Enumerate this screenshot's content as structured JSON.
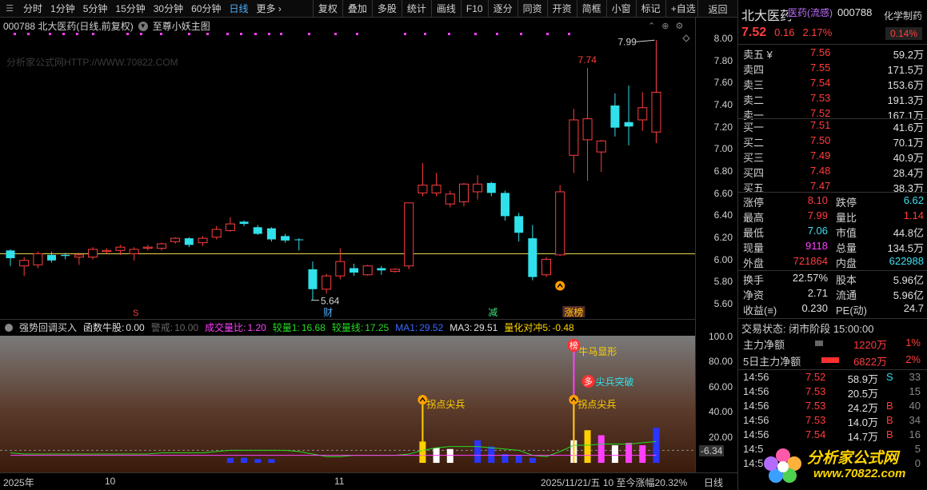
{
  "toolbar": {
    "periods": [
      "分时",
      "1分钟",
      "5分钟",
      "15分钟",
      "30分钟",
      "60分钟",
      "日线",
      "更多 ›"
    ],
    "active_period": "日线",
    "buttons": [
      "复权",
      "叠加",
      "多股",
      "统计",
      "画线",
      "F10",
      "逐分",
      "同资",
      "开资",
      "简框",
      "小窗",
      "标记",
      "+自选"
    ],
    "return_label": "返回"
  },
  "chart_header": {
    "code_text": "000788 北大医药(日线,前复权)",
    "formula_name": "至尊小妖主图",
    "watermark": "分析家公式网HTTP://WWW.70822.COM"
  },
  "main_chart": {
    "price_ticks": [
      "8.00",
      "7.80",
      "7.60",
      "7.40",
      "7.20",
      "7.00",
      "6.80",
      "6.60",
      "6.40",
      "6.20",
      "6.00",
      "5.80",
      "5.60"
    ],
    "annotations": {
      "high_label": "7.99",
      "high_mid_label": "7.74",
      "low_label": "5.64",
      "tag_cai": "财",
      "tag_jian": "减",
      "tag_zhangting": "涨榜",
      "tag_s": "S"
    }
  },
  "indicator": {
    "name": "强势回调买入",
    "items": [
      {
        "label": "函数牛股:",
        "value": "0.00",
        "color": "#e0e0e0"
      },
      {
        "label": "警戒:",
        "value": "10.00",
        "color": "#666666"
      },
      {
        "label": "成交量比:",
        "value": "1.20",
        "color": "#ff40ff"
      },
      {
        "label": "较量1:",
        "value": "16.68",
        "color": "#22dd22"
      },
      {
        "label": "较量线:",
        "value": "17.25",
        "color": "#22dd22"
      },
      {
        "label": "MA1:",
        "value": "29.52",
        "color": "#3a6cff"
      },
      {
        "label": "MA3:",
        "value": "29.51",
        "color": "#e0e0e0"
      },
      {
        "label": "量化对冲5:",
        "value": "-0.48",
        "color": "#ffd500"
      }
    ],
    "axis_ticks": [
      "100.0",
      "80.00",
      "60.00",
      "40.00",
      "20.00"
    ],
    "bottom_value": "-6.34",
    "signals": {
      "bang": "榜",
      "niuma": "牛马显形",
      "duo": "多",
      "jianbing": "尖兵突破",
      "guaidian1": "拐点尖兵",
      "guaidian2": "拐点尖兵"
    }
  },
  "date_bar": {
    "year": "2025年",
    "m10": "10",
    "m11": "11",
    "cursor": "2025/11/21/五 10 至今涨幅20.32%",
    "period": "日线"
  },
  "quote": {
    "name": "北大医药",
    "sector": "医药(流感)",
    "code": "000788",
    "industry": "化学制药",
    "price": "7.52",
    "change": "0.16",
    "change_pct": "2.17%",
    "industry_pct": "0.14%",
    "asks": [
      {
        "label": "卖五 ¥",
        "price": "7.56",
        "vol": "59.2万"
      },
      {
        "label": "卖四",
        "price": "7.55",
        "vol": "171.5万"
      },
      {
        "label": "卖三",
        "price": "7.54",
        "vol": "153.6万"
      },
      {
        "label": "卖二",
        "price": "7.53",
        "vol": "191.3万"
      },
      {
        "label": "卖一",
        "price": "7.52",
        "vol": "167.1万"
      }
    ],
    "bids": [
      {
        "label": "买一",
        "price": "7.51",
        "vol": "41.6万"
      },
      {
        "label": "买二",
        "price": "7.50",
        "vol": "70.1万"
      },
      {
        "label": "买三",
        "price": "7.49",
        "vol": "40.9万"
      },
      {
        "label": "买四",
        "price": "7.48",
        "vol": "28.4万"
      },
      {
        "label": "买五",
        "price": "7.47",
        "vol": "38.3万"
      }
    ],
    "stats1": [
      {
        "l1": "涨停",
        "v1": "8.10",
        "c1": "c-red",
        "l2": "跌停",
        "v2": "6.62",
        "c2": "c-cyan"
      },
      {
        "l1": "最高",
        "v1": "7.99",
        "c1": "c-red",
        "l2": "量比",
        "v2": "1.14",
        "c2": "c-red"
      },
      {
        "l1": "最低",
        "v1": "7.06",
        "c1": "c-cyan",
        "l2": "市值",
        "v2": "44.8亿",
        "c2": "c-white"
      },
      {
        "l1": "现量",
        "v1": "9118",
        "c1": "c-mag",
        "l2": "总量",
        "v2": "134.5万",
        "c2": "c-white"
      },
      {
        "l1": "外盘",
        "v1": "721864",
        "c1": "c-red",
        "l2": "内盘",
        "v2": "622988",
        "c2": "c-cyan"
      }
    ],
    "stats2": [
      {
        "l1": "换手",
        "v1": "22.57%",
        "c1": "c-white",
        "l2": "股本",
        "v2": "5.96亿",
        "c2": "c-white"
      },
      {
        "l1": "净资",
        "v1": "2.71",
        "c1": "c-white",
        "l2": "流通",
        "v2": "5.96亿",
        "c2": "c-white"
      },
      {
        "l1": "收益(≡)",
        "v1": "0.230",
        "c1": "c-white",
        "l2": "PE(动)",
        "v2": "24.7",
        "c2": "c-white"
      }
    ],
    "trade_status": "交易状态: 闭市阶段 15:00:00",
    "main_flow_label": "主力净额",
    "main_flow_value": "1220万",
    "main_flow_pct": "1%",
    "flow5_label": "5日主力净额",
    "flow5_value": "6822万",
    "flow5_pct": "2%",
    "ticks": [
      {
        "time": "14:56",
        "price": "7.52",
        "vol": "58.9万",
        "side": "S",
        "n": "33"
      },
      {
        "time": "14:56",
        "price": "7.53",
        "vol": "20.5万",
        "side": "",
        "n": "15"
      },
      {
        "time": "14:56",
        "price": "7.53",
        "vol": "24.2万",
        "side": "B",
        "n": "40"
      },
      {
        "time": "14:56",
        "price": "7.53",
        "vol": "14.0万",
        "side": "B",
        "n": "34"
      },
      {
        "time": "14:56",
        "price": "7.54",
        "vol": "14.7万",
        "side": "B",
        "n": "16"
      },
      {
        "time": "14:5",
        "price": "",
        "vol": "",
        "side": "",
        "n": "5"
      },
      {
        "time": "14:5",
        "price": "",
        "vol": "",
        "side": "",
        "n": "0"
      }
    ],
    "logo_main": "分析家公式网",
    "logo_url": "www.70822.com"
  },
  "chart_data": [
    {
      "type": "candlestick",
      "title": "000788 北大医药(日线,前复权)",
      "ylim": [
        5.5,
        8.05
      ],
      "reference_line": 6.06,
      "candles": [
        {
          "o": 6.02,
          "h": 6.1,
          "l": 5.95,
          "c": 6.09,
          "up": false
        },
        {
          "o": 6.0,
          "h": 6.03,
          "l": 5.86,
          "c": 5.95,
          "up": true
        },
        {
          "o": 5.96,
          "h": 6.08,
          "l": 5.93,
          "c": 6.06,
          "up": true
        },
        {
          "o": 6.05,
          "h": 6.08,
          "l": 5.98,
          "c": 6.0,
          "up": false
        },
        {
          "o": 6.05,
          "h": 6.07,
          "l": 6.01,
          "c": 6.04,
          "up": false
        },
        {
          "o": 6.03,
          "h": 6.07,
          "l": 5.96,
          "c": 6.05,
          "up": true
        },
        {
          "o": 6.03,
          "h": 6.12,
          "l": 6.01,
          "c": 6.1,
          "up": true
        },
        {
          "o": 6.08,
          "h": 6.11,
          "l": 6.06,
          "c": 6.09,
          "up": true
        },
        {
          "o": 6.09,
          "h": 6.14,
          "l": 6.05,
          "c": 6.12,
          "up": true
        },
        {
          "o": 6.1,
          "h": 6.12,
          "l": 6.0,
          "c": 6.06,
          "up": true
        },
        {
          "o": 6.11,
          "h": 6.14,
          "l": 6.09,
          "c": 6.12,
          "up": true
        },
        {
          "o": 6.11,
          "h": 6.16,
          "l": 6.09,
          "c": 6.15,
          "up": true
        },
        {
          "o": 6.17,
          "h": 6.21,
          "l": 6.15,
          "c": 6.2,
          "up": true
        },
        {
          "o": 6.2,
          "h": 6.21,
          "l": 6.12,
          "c": 6.14,
          "up": false
        },
        {
          "o": 6.16,
          "h": 6.22,
          "l": 6.13,
          "c": 6.2,
          "up": true
        },
        {
          "o": 6.21,
          "h": 6.31,
          "l": 6.19,
          "c": 6.28,
          "up": true
        },
        {
          "o": 6.27,
          "h": 6.39,
          "l": 6.26,
          "c": 6.33,
          "up": true
        },
        {
          "o": 6.35,
          "h": 6.36,
          "l": 6.31,
          "c": 6.33,
          "up": false
        },
        {
          "o": 6.3,
          "h": 6.32,
          "l": 6.23,
          "c": 6.24,
          "up": false
        },
        {
          "o": 6.29,
          "h": 6.3,
          "l": 6.17,
          "c": 6.19,
          "up": false
        },
        {
          "o": 6.22,
          "h": 6.24,
          "l": 6.16,
          "c": 6.18,
          "up": false
        },
        {
          "o": 6.19,
          "h": 6.2,
          "l": 6.09,
          "c": 6.19,
          "up": false
        },
        {
          "o": 5.92,
          "h": 5.99,
          "l": 5.64,
          "c": 5.74,
          "up": false
        },
        {
          "o": 5.74,
          "h": 5.88,
          "l": 5.7,
          "c": 5.86,
          "up": true
        },
        {
          "o": 5.86,
          "h": 6.11,
          "l": 5.83,
          "c": 5.99,
          "up": true
        },
        {
          "o": 5.93,
          "h": 5.97,
          "l": 5.86,
          "c": 5.89,
          "up": false
        },
        {
          "o": 5.87,
          "h": 5.96,
          "l": 5.86,
          "c": 5.95,
          "up": true
        },
        {
          "o": 5.93,
          "h": 5.95,
          "l": 5.87,
          "c": 5.91,
          "up": false
        },
        {
          "o": 5.92,
          "h": 5.93,
          "l": 5.89,
          "c": 5.9,
          "up": true
        },
        {
          "o": 5.95,
          "h": 6.52,
          "l": 5.92,
          "c": 6.52,
          "up": true
        },
        {
          "o": 6.68,
          "h": 6.88,
          "l": 6.58,
          "c": 6.61,
          "up": true
        },
        {
          "o": 6.61,
          "h": 6.79,
          "l": 6.58,
          "c": 6.68,
          "up": true
        },
        {
          "o": 6.6,
          "h": 6.63,
          "l": 6.48,
          "c": 6.51,
          "up": true
        },
        {
          "o": 6.53,
          "h": 6.7,
          "l": 6.49,
          "c": 6.69,
          "up": true
        },
        {
          "o": 6.69,
          "h": 6.77,
          "l": 6.55,
          "c": 6.62,
          "up": true
        },
        {
          "o": 6.7,
          "h": 6.71,
          "l": 6.58,
          "c": 6.61,
          "up": false
        },
        {
          "o": 6.61,
          "h": 6.63,
          "l": 6.36,
          "c": 6.4,
          "up": false
        },
        {
          "o": 6.4,
          "h": 6.43,
          "l": 6.17,
          "c": 6.25,
          "up": false
        },
        {
          "o": 6.2,
          "h": 6.32,
          "l": 5.82,
          "c": 5.85,
          "up": false
        },
        {
          "o": 5.87,
          "h": 6.03,
          "l": 5.85,
          "c": 6.01,
          "up": true
        },
        {
          "o": 6.05,
          "h": 6.68,
          "l": 6.04,
          "c": 6.62,
          "up": true
        },
        {
          "o": 6.95,
          "h": 7.37,
          "l": 6.79,
          "c": 7.27,
          "up": true
        },
        {
          "o": 7.28,
          "h": 7.74,
          "l": 6.72,
          "c": 7.09,
          "up": true
        },
        {
          "o": 6.98,
          "h": 7.09,
          "l": 6.8,
          "c": 7.08,
          "up": true
        },
        {
          "o": 7.4,
          "h": 7.51,
          "l": 7.12,
          "c": 7.2,
          "up": false
        },
        {
          "o": 7.25,
          "h": 7.58,
          "l": 7.04,
          "c": 7.21,
          "up": false
        },
        {
          "o": 7.27,
          "h": 7.52,
          "l": 7.17,
          "c": 7.38,
          "up": true
        },
        {
          "o": 7.16,
          "h": 7.99,
          "l": 7.06,
          "c": 7.52,
          "up": true
        }
      ]
    },
    {
      "type": "bar",
      "title": "强势回调买入",
      "ylim": [
        -6.34,
        100
      ],
      "bars": [
        {
          "i": 16,
          "v": 4,
          "color": "#2a36ff"
        },
        {
          "i": 17,
          "v": 4,
          "color": "#2a36ff"
        },
        {
          "i": 18,
          "v": 3,
          "color": "#2a36ff"
        },
        {
          "i": 19,
          "v": 3,
          "color": "#2a36ff"
        },
        {
          "i": 30,
          "v": 17,
          "color": "#ffd000"
        },
        {
          "i": 31,
          "v": 12,
          "color": "#ffffff"
        },
        {
          "i": 32,
          "v": 11,
          "color": "#ffffff"
        },
        {
          "i": 34,
          "v": 18,
          "color": "#2a36ff"
        },
        {
          "i": 35,
          "v": 13,
          "color": "#2a36ff"
        },
        {
          "i": 36,
          "v": 7,
          "color": "#2a36ff"
        },
        {
          "i": 37,
          "v": 6,
          "color": "#2a36ff"
        },
        {
          "i": 38,
          "v": 4,
          "color": "#2a36ff"
        },
        {
          "i": 41,
          "v": 18,
          "color": "#ffffff"
        },
        {
          "i": 42,
          "v": 26,
          "color": "#ffd000"
        },
        {
          "i": 43,
          "v": 22,
          "color": "#ff40ff"
        },
        {
          "i": 44,
          "v": 14,
          "color": "#ffffff"
        },
        {
          "i": 45,
          "v": 16,
          "color": "#ff40ff"
        },
        {
          "i": 46,
          "v": 14,
          "color": "#ff40ff"
        },
        {
          "i": 47,
          "v": 28,
          "color": "#2a36ff"
        }
      ],
      "line_green": [
        8,
        7,
        7,
        7,
        7,
        7,
        7,
        7,
        7,
        7,
        7,
        8,
        8,
        8,
        8,
        9,
        10,
        10,
        10,
        10,
        10,
        9,
        7,
        5,
        5,
        6,
        6,
        6,
        6,
        7,
        10,
        12,
        13,
        13,
        13,
        12,
        11,
        10,
        6,
        5,
        9,
        14,
        14,
        15,
        15,
        15,
        16,
        17
      ],
      "line_magenta": [
        1,
        1,
        1,
        1,
        1,
        1,
        1,
        1,
        1,
        1,
        1,
        1,
        1,
        1,
        1,
        1,
        1,
        1,
        1,
        1,
        1,
        1,
        1,
        1,
        1,
        1,
        1,
        1,
        1,
        1,
        1,
        1,
        1,
        1,
        1,
        1,
        1,
        1,
        1,
        1,
        1,
        1,
        1,
        1,
        1,
        1,
        1,
        1
      ]
    }
  ]
}
